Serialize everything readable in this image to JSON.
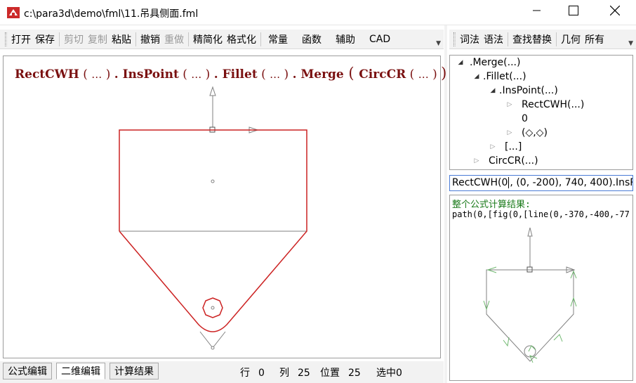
{
  "window": {
    "title": "c:\\para3d\\demo\\fml\\11.吊具侧面.fml",
    "controls": [
      "minimize",
      "maximize",
      "close"
    ]
  },
  "toolbar_left": {
    "groups": [
      [
        {
          "label": "打开",
          "enabled": true
        },
        {
          "label": "保存",
          "enabled": true
        }
      ],
      [
        {
          "label": "剪切",
          "enabled": false
        },
        {
          "label": "复制",
          "enabled": false
        },
        {
          "label": "粘贴",
          "enabled": true
        }
      ],
      [
        {
          "label": "撤销",
          "enabled": true
        },
        {
          "label": "重做",
          "enabled": false
        }
      ],
      [
        {
          "label": "精简化",
          "enabled": true
        },
        {
          "label": "格式化",
          "enabled": true
        }
      ],
      [
        {
          "label": "常量",
          "enabled": true
        },
        {
          "label": "函数",
          "enabled": true
        },
        {
          "label": "辅助",
          "enabled": true
        },
        {
          "label": "CAD",
          "enabled": true
        }
      ]
    ]
  },
  "toolbar_right": {
    "groups": [
      [
        {
          "label": "词法",
          "enabled": true
        },
        {
          "label": "语法",
          "enabled": true
        }
      ],
      [
        {
          "label": "查找替换",
          "enabled": true
        }
      ],
      [
        {
          "label": "几何",
          "enabled": true
        },
        {
          "label": "所有",
          "enabled": true
        }
      ]
    ]
  },
  "formula_display": {
    "parts": [
      {
        "fn": "RectCWH",
        "args": "…"
      },
      {
        "fn": "InsPoint",
        "args": "…"
      },
      {
        "fn": "Fillet",
        "args": "…"
      },
      {
        "fn": "Merge",
        "inner_fn": "CircCR",
        "inner_args": "…"
      }
    ],
    "colors": {
      "formula": "#7a1010",
      "shape": "#cc2222",
      "helper": "#808080"
    }
  },
  "tree": {
    "rows": [
      {
        "label": ".Merge(...)",
        "indent": 0,
        "state": "open"
      },
      {
        "label": ".Fillet(...)",
        "indent": 1,
        "state": "open"
      },
      {
        "label": ".InsPoint(...)",
        "indent": 2,
        "state": "open"
      },
      {
        "label": "RectCWH(...)",
        "indent": 3,
        "state": "closed"
      },
      {
        "label": "0",
        "indent": 3,
        "state": "leaf"
      },
      {
        "label": "(◇,◇)",
        "indent": 3,
        "state": "closed"
      },
      {
        "label": "[...]",
        "indent": 2,
        "state": "closed"
      },
      {
        "label": "CircCR(...)",
        "indent": 1,
        "state": "closed"
      }
    ]
  },
  "formula_input": {
    "before_caret": "RectCWH(0",
    "after_caret": ", (0, -200), 740, 400).InsP"
  },
  "result": {
    "title": "整个公式计算结果:",
    "text": "path(0,[fig(0,[line(0,-370,-400,-77",
    "mini_color": "#6fb86f"
  },
  "bottom_tabs": [
    {
      "label": "公式编辑",
      "active": false
    },
    {
      "label": "二维编辑",
      "active": true
    },
    {
      "label": "计算结果",
      "active": false
    }
  ],
  "status": {
    "row_label": "行",
    "row_value": "0",
    "col_label": "列",
    "col_value": "25",
    "pos_label": "位置",
    "pos_value": "25",
    "sel_label": "选中",
    "sel_value": "0"
  }
}
